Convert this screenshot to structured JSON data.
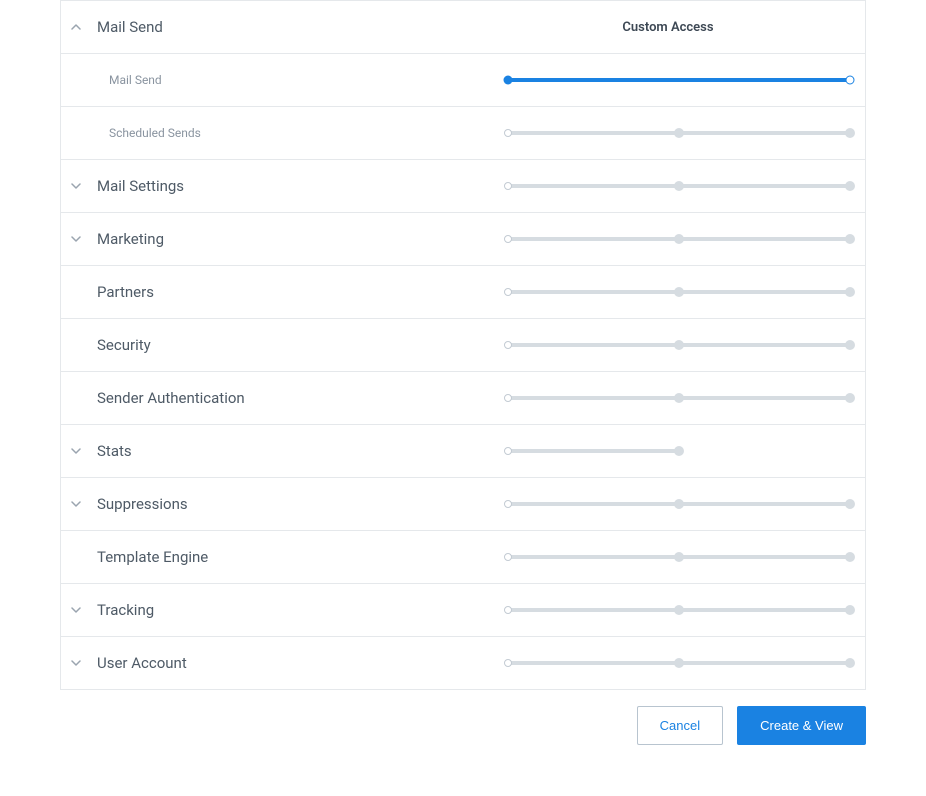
{
  "header": {
    "title": "Mail Send",
    "access_label": "Custom Access"
  },
  "rows": [
    {
      "label": "Mail Send",
      "kind": "sub",
      "slider": "full_blue"
    },
    {
      "label": "Scheduled Sends",
      "kind": "sub",
      "slider": "three"
    },
    {
      "label": "Mail Settings",
      "kind": "group",
      "slider": "three"
    },
    {
      "label": "Marketing",
      "kind": "group",
      "slider": "three"
    },
    {
      "label": "Partners",
      "kind": "plain",
      "slider": "three"
    },
    {
      "label": "Security",
      "kind": "plain",
      "slider": "three"
    },
    {
      "label": "Sender Authentication",
      "kind": "plain",
      "slider": "three"
    },
    {
      "label": "Stats",
      "kind": "group",
      "slider": "half"
    },
    {
      "label": "Suppressions",
      "kind": "group",
      "slider": "three"
    },
    {
      "label": "Template Engine",
      "kind": "plain",
      "slider": "three"
    },
    {
      "label": "Tracking",
      "kind": "group",
      "slider": "three"
    },
    {
      "label": "User Account",
      "kind": "group",
      "slider": "three"
    }
  ],
  "buttons": {
    "cancel": "Cancel",
    "submit": "Create & View"
  }
}
